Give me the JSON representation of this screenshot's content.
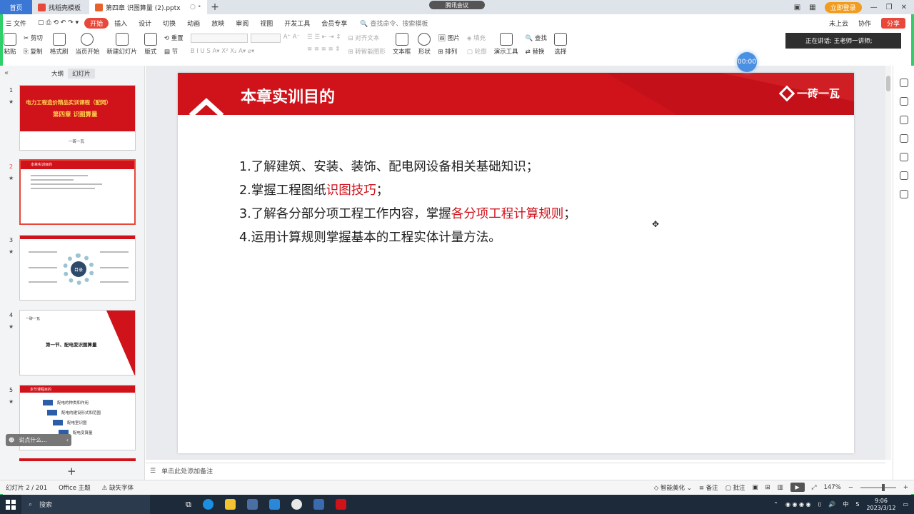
{
  "tabs": {
    "home": "首页",
    "template": "找稻壳模板",
    "document": "第四章  识图算量 (2).pptx"
  },
  "meeting_label": "腾讯会议",
  "window": {
    "login": "立即登录",
    "min": "—",
    "restore": "❐",
    "close": "✕"
  },
  "menu": {
    "file": "文件",
    "items": [
      "开始",
      "插入",
      "设计",
      "切换",
      "动画",
      "放映",
      "审阅",
      "视图",
      "开发工具",
      "会员专享"
    ],
    "search": "查找命令、搜索模板",
    "cloud": "未上云",
    "collab": "协作",
    "share": "分享"
  },
  "ribbon": {
    "paste": "粘贴",
    "cut": "剪切",
    "copy": "复制",
    "format_painter": "格式刷",
    "play_from_current": "当页开始",
    "new_slide": "新建幻灯片",
    "layout": "版式",
    "reset": "重置",
    "section": "节",
    "align_text": "对齐文本",
    "convert_graphic": "转智能图形",
    "textbox": "文本框",
    "shape": "形状",
    "picture": "图片",
    "arrange": "排列",
    "fill": "填充",
    "outline": "轮廓",
    "presentation_tools": "演示工具",
    "find": "查找",
    "replace": "替换",
    "select": "选择"
  },
  "speaker": "正在讲话: 王老师一讲师;",
  "left_panel": {
    "tab_outline": "大纲",
    "tab_slides": "幻灯片",
    "thumbs": [
      {
        "num": "1",
        "title": "电力工程造价精品实训课程（配网）",
        "subtitle": "第四章  识图算量",
        "brand": "一砖一瓦"
      },
      {
        "num": "2",
        "title": "本章实训目的"
      },
      {
        "num": "3",
        "center": "目录"
      },
      {
        "num": "4",
        "title": "第一节、配电变识图算量",
        "brand": "一砖一瓦"
      },
      {
        "num": "5",
        "title": "本节课程目的",
        "items": [
          "配电的种类和作用",
          "配电的建设形式和范围",
          "配电室识图",
          "配电变算量"
        ]
      }
    ],
    "ask": "说点什么..."
  },
  "slide": {
    "title": "本章实训目的",
    "brand": "一砖一瓦",
    "lines": [
      {
        "pre": "1.了解建筑、安装、装饰、配电网设备相关基础知识；",
        "hl": "",
        "post": ""
      },
      {
        "pre": "2.掌握工程图纸",
        "hl": "识图技巧",
        "post": "；"
      },
      {
        "pre": "3.了解各分部分项工程工作内容，掌握",
        "hl": "各分项工程计算规则",
        "post": "；"
      },
      {
        "pre": "4.运用计算规则掌握基本的工程实体计量方法。",
        "hl": "",
        "post": ""
      }
    ]
  },
  "timer": "00:00",
  "notes_placeholder": "单击此处添加备注",
  "status": {
    "slide_count": "幻灯片 2 / 201",
    "theme": "Office 主题",
    "missing_font": "缺失字体",
    "smart_beautify": "智能美化",
    "notes": "备注",
    "annotate": "批注",
    "zoom": "147%"
  },
  "taskbar": {
    "search": "搜索",
    "time": "9:06",
    "date": "2023/3/12",
    "ime": "中"
  },
  "colors": {
    "accent_red": "#d0121b",
    "wps_red": "#e8483a",
    "taskbar": "#1d2a3a"
  }
}
